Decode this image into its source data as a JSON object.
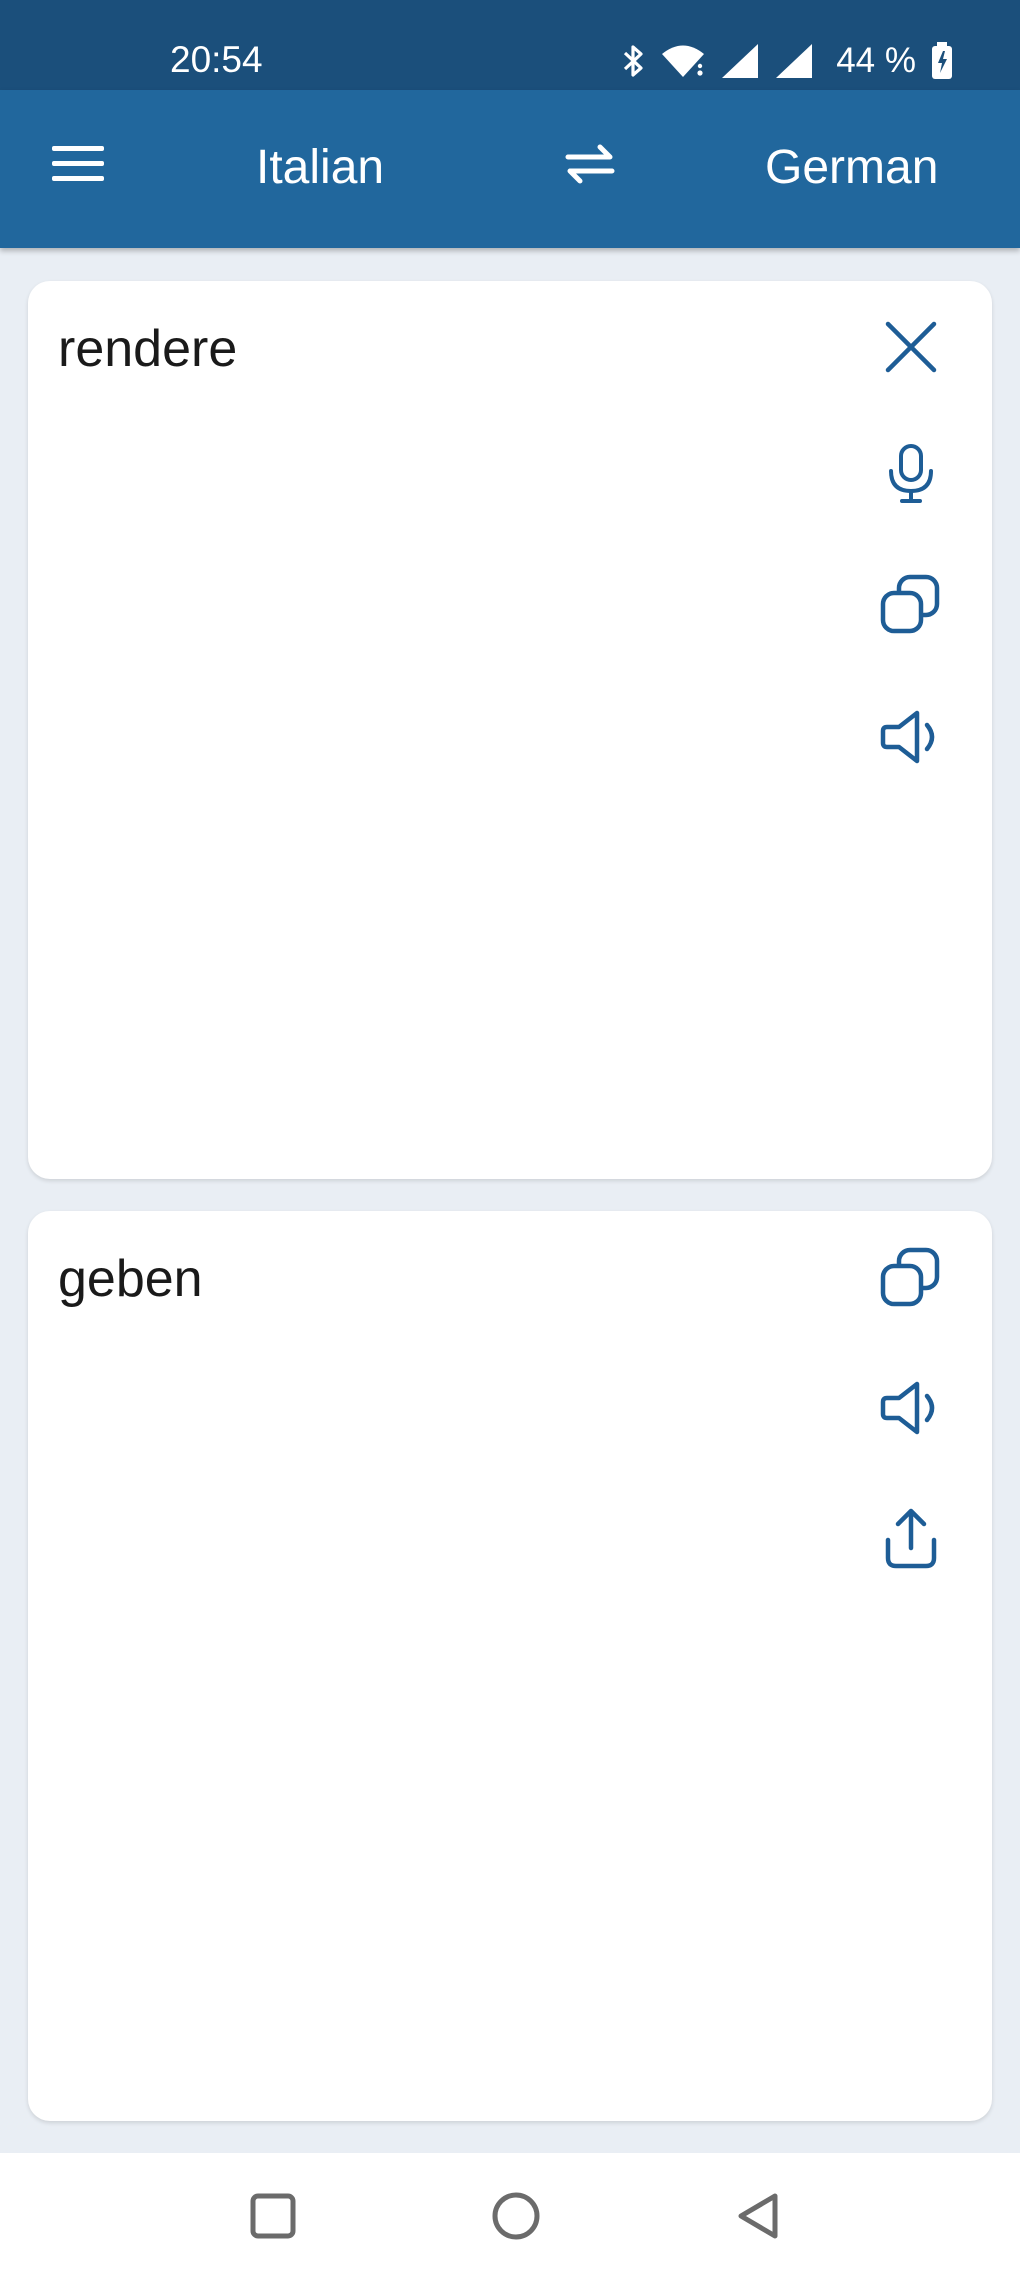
{
  "status_bar": {
    "time": "20:54",
    "battery_percent": "44 %",
    "icons": [
      "bluetooth-icon",
      "wifi-icon",
      "signal-icon",
      "signal-icon",
      "battery-charging-icon"
    ]
  },
  "app_bar": {
    "source_language": "Italian",
    "target_language": "German",
    "icons": [
      "menu-icon",
      "swap-icon"
    ]
  },
  "source_card": {
    "text": "rendere",
    "actions": [
      "close-icon",
      "microphone-icon",
      "copy-icon",
      "speaker-icon"
    ]
  },
  "target_card": {
    "text": "geben",
    "actions": [
      "copy-icon",
      "speaker-icon",
      "share-icon"
    ]
  },
  "nav_bar": {
    "buttons": [
      "recents-square-icon",
      "home-circle-icon",
      "back-triangle-icon"
    ]
  },
  "colors": {
    "status_bar": "#1b4f7b",
    "app_bar": "#21679d",
    "background": "#e9eef4",
    "icon_accent": "#1e5d96"
  }
}
